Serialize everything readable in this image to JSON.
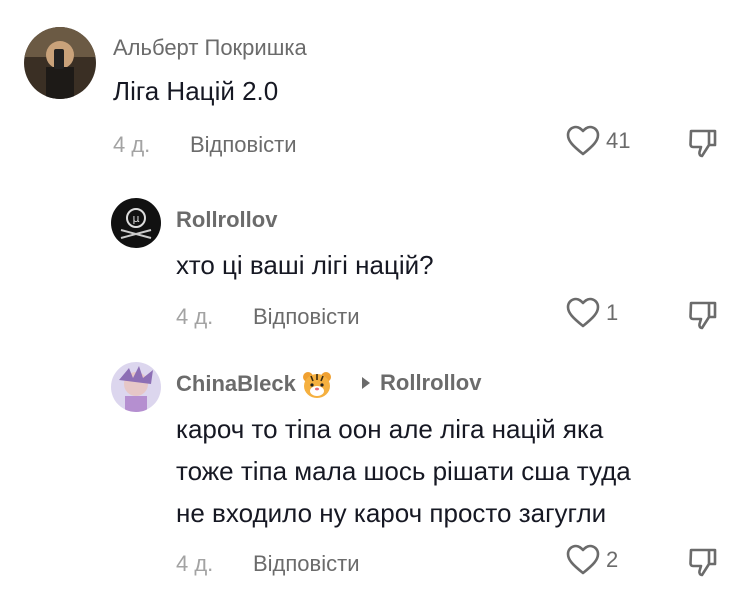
{
  "comments": [
    {
      "author": "Альберт Покришка",
      "text": "Ліга Націй 2.0",
      "time": "4 д.",
      "reply_label": "Відповісти",
      "likes": "41"
    },
    {
      "author": "Rollrollov",
      "text": "хто ці ваші лігі націй?",
      "time": "4 д.",
      "reply_label": "Відповісти",
      "likes": "1"
    },
    {
      "author": "ChinaBleck",
      "reply_to": "Rollrollov",
      "text_lines": [
        "кароч то тіпа оон але ліга націй яка",
        "тоже тіпа мала шось рішати сша туда",
        "не входило ну кароч просто загугли"
      ],
      "time": "4 д.",
      "reply_label": "Відповісти",
      "likes": "2"
    }
  ],
  "icons": {
    "like": "heart-outline-icon",
    "dislike": "thumbs-down-outline-icon",
    "author_emoji": "tiger-face-icon"
  }
}
